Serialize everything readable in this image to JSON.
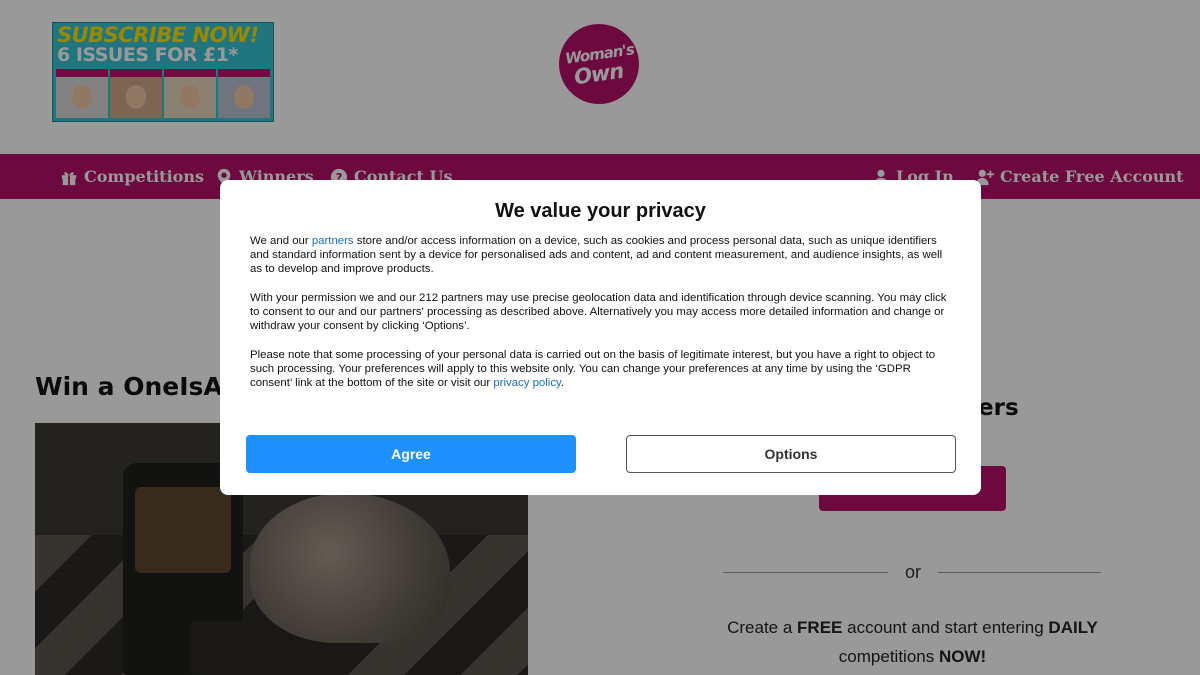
{
  "header": {
    "promo": {
      "line1": "SUBSCRIBE NOW!",
      "line2": "6 ISSUES FOR £1*"
    },
    "logo": {
      "line1": "Woman's",
      "line2": "Own"
    }
  },
  "nav": {
    "items": [
      {
        "label": "Competitions",
        "icon": "gift-icon"
      },
      {
        "label": "Winners",
        "icon": "map-pin-icon"
      },
      {
        "label": "Contact Us",
        "icon": "question-circle-icon"
      }
    ],
    "right": [
      {
        "label": "Log In",
        "icon": "user-icon"
      },
      {
        "label": "Create Free Account",
        "icon": "user-plus-icon"
      }
    ],
    "color": "#b5126a"
  },
  "main": {
    "competition_title": "Win a OneIsAll",
    "side_heading_partial": "ers",
    "or_text": "or",
    "cta": {
      "part1": "Create a ",
      "bold1": "FREE",
      "part2": " account and start entering ",
      "bold2": "DAILY",
      "part3": "competitions ",
      "bold3": "NOW!"
    }
  },
  "consent": {
    "title": "We value your privacy",
    "p1_before": "We and our ",
    "p1_link": "partners",
    "p1_after": " store and/or access information on a device, such as cookies and process personal data, such as unique identifiers and standard information sent by a device for personalised ads and content, ad and content measurement, and audience insights, as well as to develop and improve products.",
    "p2": "With your permission we and our 212 partners may use precise geolocation data and identification through device scanning. You may click to consent to our and our partners' processing as described above. Alternatively you may access more detailed information and change or withdraw your consent by clicking ‘Options’.",
    "p3_before": "Please note that some processing of your personal data is carried out on the basis of legitimate interest, but you have a right to object to such processing. Your preferences will apply to this website only. You can change your preferences at any time by using the ‘GDPR consent’ link at the bottom of the site or visit our ",
    "p3_link": "privacy policy",
    "p3_after": ".",
    "agree_label": "Agree",
    "options_label": "Options",
    "agree_color": "#1e90ff"
  }
}
